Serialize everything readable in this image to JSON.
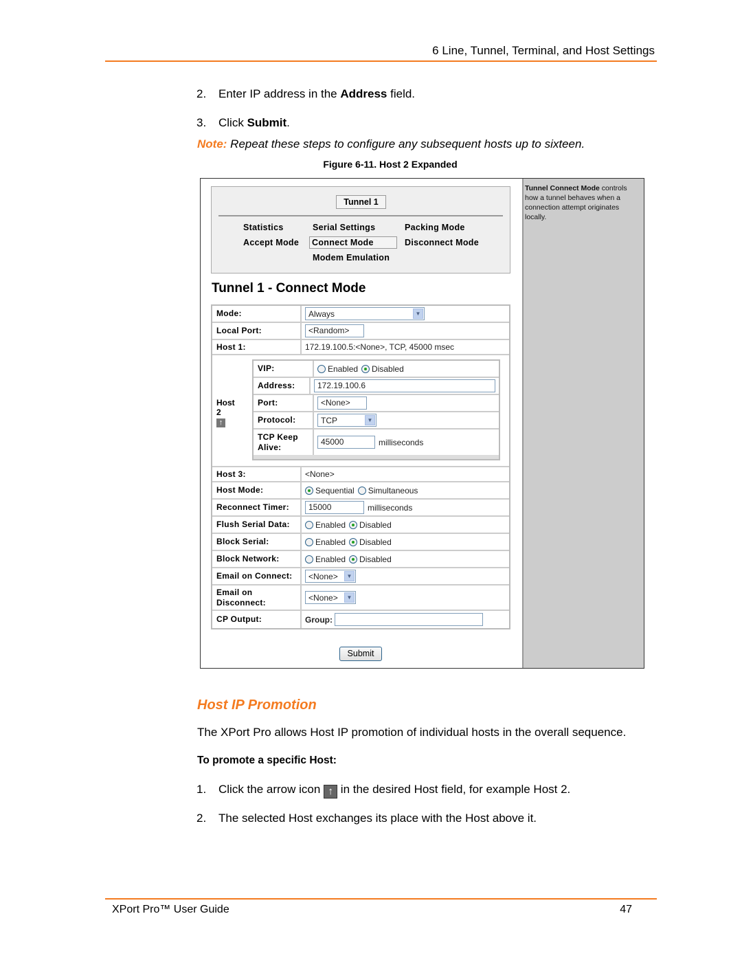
{
  "header": {
    "chapter": "6 Line, Tunnel, Terminal, and Host Settings",
    "accent_color": "#f47b20"
  },
  "steps_top": [
    {
      "num": "2.",
      "pre": "Enter IP address in the ",
      "bold": "Address",
      "post": " field."
    },
    {
      "num": "3.",
      "pre": "Click ",
      "bold": "Submit",
      "post": "."
    }
  ],
  "note": {
    "label": "Note:",
    "text": " Repeat these steps to configure any subsequent hosts up to sixteen."
  },
  "figure_caption": "Figure 6-11. Host 2 Expanded",
  "figure": {
    "help": {
      "bold": "Tunnel Connect Mode",
      "text": " controls how a tunnel behaves when a connection attempt originates locally."
    },
    "nav": {
      "tunnel": "Tunnel 1",
      "items": [
        "Statistics",
        "Serial Settings",
        "Packing Mode",
        "Accept Mode",
        "Connect Mode",
        "Disconnect Mode",
        "Modem Emulation"
      ],
      "active": "Connect Mode"
    },
    "title": "Tunnel 1 - Connect Mode",
    "form": {
      "mode": {
        "label": "Mode:",
        "value": "Always"
      },
      "local_port": {
        "label": "Local Port:",
        "value": "<Random>"
      },
      "host1": {
        "label": "Host 1:",
        "value": "172.19.100.5:<None>, TCP, 45000 msec"
      },
      "host2": {
        "label": "Host",
        "number": "2",
        "vip": {
          "label": "VIP:",
          "options": [
            "Enabled",
            "Disabled"
          ],
          "selected": "Disabled"
        },
        "address": {
          "label": "Address:",
          "value": "172.19.100.6"
        },
        "port": {
          "label": "Port:",
          "value": "<None>"
        },
        "protocol": {
          "label": "Protocol:",
          "value": "TCP"
        },
        "keepalive": {
          "label": "TCP Keep Alive:",
          "value": "45000",
          "unit": "milliseconds"
        }
      },
      "host3": {
        "label": "Host 3:",
        "value": "<None>"
      },
      "host_mode": {
        "label": "Host Mode:",
        "options": [
          "Sequential",
          "Simultaneous"
        ],
        "selected": "Sequential"
      },
      "reconnect": {
        "label": "Reconnect Timer:",
        "value": "15000",
        "unit": "milliseconds"
      },
      "flush": {
        "label": "Flush Serial Data:",
        "options": [
          "Enabled",
          "Disabled"
        ],
        "selected": "Disabled"
      },
      "block_serial": {
        "label": "Block Serial:",
        "options": [
          "Enabled",
          "Disabled"
        ],
        "selected": "Disabled"
      },
      "block_network": {
        "label": "Block Network:",
        "options": [
          "Enabled",
          "Disabled"
        ],
        "selected": "Disabled"
      },
      "email_connect": {
        "label": "Email on Connect:",
        "value": "<None>"
      },
      "email_disconnect": {
        "label": "Email on Disconnect:",
        "value": "<None>"
      },
      "cp_output": {
        "label": "CP Output:",
        "group_label": "Group:",
        "value": ""
      },
      "submit": "Submit"
    }
  },
  "section": {
    "heading": "Host IP Promotion",
    "para": "The XPort Pro allows Host IP promotion of individual hosts in the overall sequence.",
    "subhead": "To promote a specific Host:",
    "steps": [
      {
        "num": "1.",
        "pre": "Click the arrow icon ",
        "post": " in the desired Host field, for example Host 2."
      },
      {
        "num": "2.",
        "text": "The selected Host exchanges its place with the Host above it."
      }
    ]
  },
  "footer": {
    "title": "XPort Pro™ User Guide",
    "page": "47"
  }
}
